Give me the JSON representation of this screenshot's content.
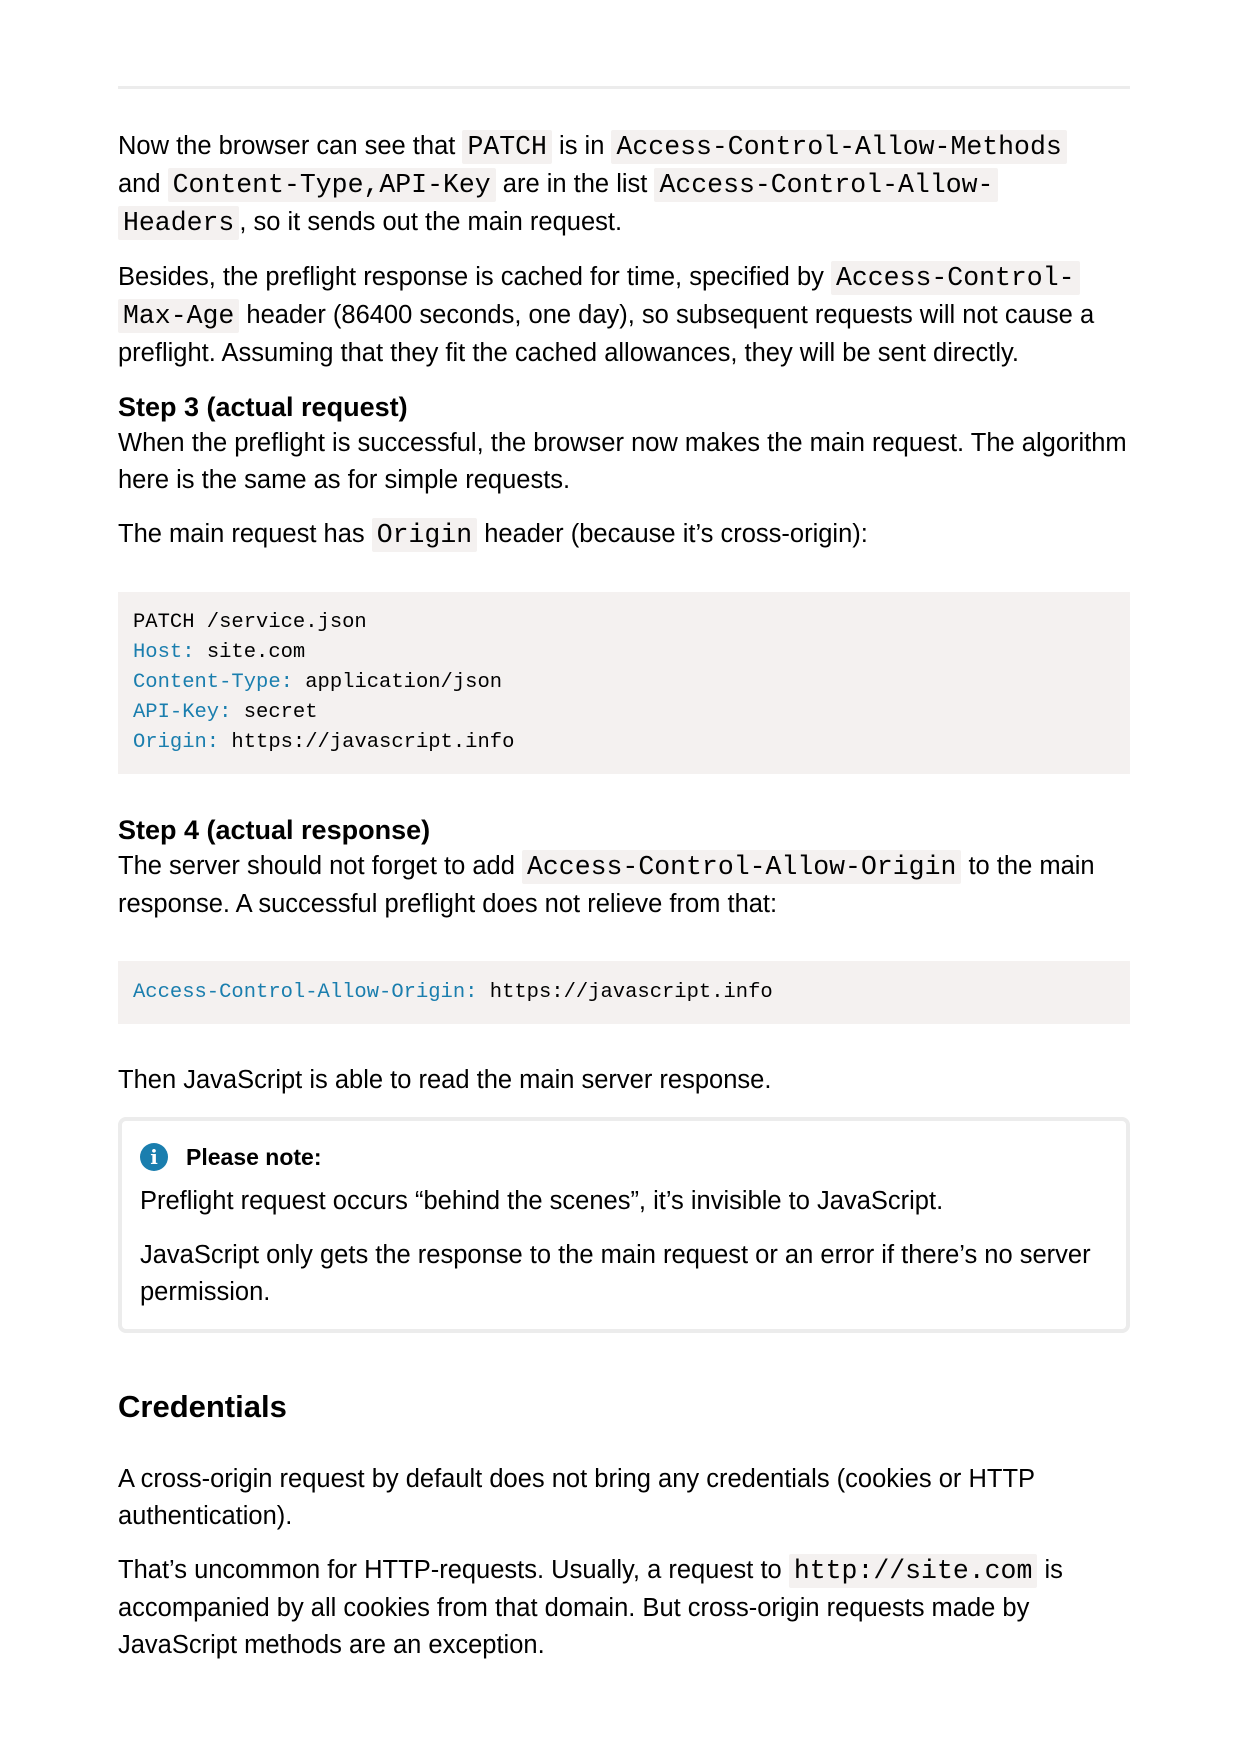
{
  "para1": {
    "t1": "Now the browser can see that ",
    "c1": "PATCH",
    "t2": " is in ",
    "c2": "Access-Control-Allow-Methods",
    "t3": " and ",
    "c3": "Content-Type,API-Key",
    "t4": " are in the list ",
    "c4a": "Access-Control-Allow-",
    "c4b": "Headers",
    "t5": ", so it sends out the main request."
  },
  "para2": {
    "t1": "Besides, the preflight response is cached for time, specified by ",
    "c1a": "Access-Control-",
    "c1b": "Max-Age",
    "t2": " header (86400 seconds, one day), so subsequent requests will not cause a preflight. Assuming that they fit the cached allowances, they will be sent directly."
  },
  "step3": {
    "heading": "Step 3 (actual request)",
    "para1": "When the preflight is successful, the browser now makes the main request. The algorithm here is the same as for simple requests.",
    "para2_t1": "The main request has ",
    "para2_code": "Origin",
    "para2_t2": " header (because it’s cross-origin):",
    "code": {
      "line1": "PATCH /service.json",
      "lines": [
        {
          "key": "Host:",
          "value": " site.com"
        },
        {
          "key": "Content-Type:",
          "value": " application/json"
        },
        {
          "key": "API-Key:",
          "value": " secret"
        },
        {
          "key": "Origin:",
          "value": " https://javascript.info"
        }
      ]
    }
  },
  "step4": {
    "heading": "Step 4 (actual response)",
    "para_t1": "The server should not forget to add ",
    "para_code": "Access-Control-Allow-Origin",
    "para_t2": " to the main response. A successful preflight does not relieve from that:",
    "code": {
      "key": "Access-Control-Allow-Origin:",
      "value": " https://javascript.info"
    },
    "after": "Then JavaScript is able to read the main server response."
  },
  "note": {
    "icon": "info-icon",
    "icon_glyph": "i",
    "title": "Please note:",
    "para1": "Preflight request occurs “behind the scenes”, it’s invisible to JavaScript.",
    "para2": "JavaScript only gets the response to the main request or an error if there’s no server permission."
  },
  "credentials": {
    "heading": "Credentials",
    "para1": "A cross-origin request by default does not bring any credentials (cookies or HTTP authentication).",
    "para2_t1": "That’s uncommon for HTTP-requests. Usually, a request to ",
    "para2_code": "http://site.com",
    "para2_t2": " is accompanied by all cookies from that domain. But cross-origin requests made by JavaScript methods are an exception."
  },
  "colors": {
    "header_key": "#1a7eae",
    "code_bg": "#f4f1f0",
    "rule": "#ececec"
  }
}
